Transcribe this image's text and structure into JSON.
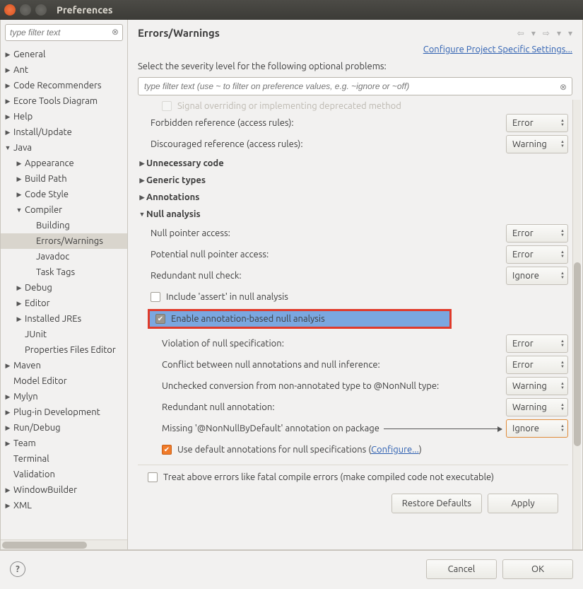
{
  "window": {
    "title": "Preferences"
  },
  "sidebar": {
    "filter_placeholder": "type filter text",
    "items": [
      {
        "label": "General",
        "expand": "▶",
        "depth": 0
      },
      {
        "label": "Ant",
        "expand": "▶",
        "depth": 0
      },
      {
        "label": "Code Recommenders",
        "expand": "▶",
        "depth": 0
      },
      {
        "label": "Ecore Tools Diagram",
        "expand": "▶",
        "depth": 0
      },
      {
        "label": "Help",
        "expand": "▶",
        "depth": 0
      },
      {
        "label": "Install/Update",
        "expand": "▶",
        "depth": 0
      },
      {
        "label": "Java",
        "expand": "▼",
        "depth": 0
      },
      {
        "label": "Appearance",
        "expand": "▶",
        "depth": 1
      },
      {
        "label": "Build Path",
        "expand": "▶",
        "depth": 1
      },
      {
        "label": "Code Style",
        "expand": "▶",
        "depth": 1
      },
      {
        "label": "Compiler",
        "expand": "▼",
        "depth": 1
      },
      {
        "label": "Building",
        "expand": "",
        "depth": 2
      },
      {
        "label": "Errors/Warnings",
        "expand": "",
        "depth": 2,
        "selected": true
      },
      {
        "label": "Javadoc",
        "expand": "",
        "depth": 2
      },
      {
        "label": "Task Tags",
        "expand": "",
        "depth": 2
      },
      {
        "label": "Debug",
        "expand": "▶",
        "depth": 1
      },
      {
        "label": "Editor",
        "expand": "▶",
        "depth": 1
      },
      {
        "label": "Installed JREs",
        "expand": "▶",
        "depth": 1
      },
      {
        "label": "JUnit",
        "expand": "",
        "depth": 1
      },
      {
        "label": "Properties Files Editor",
        "expand": "",
        "depth": 1
      },
      {
        "label": "Maven",
        "expand": "▶",
        "depth": 0
      },
      {
        "label": "Model Editor",
        "expand": "",
        "depth": 0
      },
      {
        "label": "Mylyn",
        "expand": "▶",
        "depth": 0
      },
      {
        "label": "Plug-in Development",
        "expand": "▶",
        "depth": 0
      },
      {
        "label": "Run/Debug",
        "expand": "▶",
        "depth": 0
      },
      {
        "label": "Team",
        "expand": "▶",
        "depth": 0
      },
      {
        "label": "Terminal",
        "expand": "",
        "depth": 0
      },
      {
        "label": "Validation",
        "expand": "",
        "depth": 0
      },
      {
        "label": "WindowBuilder",
        "expand": "▶",
        "depth": 0
      },
      {
        "label": "XML",
        "expand": "▶",
        "depth": 0
      }
    ]
  },
  "main": {
    "title": "Errors/Warnings",
    "config_link": "Configure Project Specific Settings...",
    "instruction": "Select the severity level for the following optional problems:",
    "filter_placeholder": "type filter text (use ~ to filter on preference values, e.g. ~ignore or ~off)",
    "cut_row": "Signal overriding or implementing deprecated method",
    "rows": {
      "forbidden": {
        "label": "Forbidden reference (access rules):",
        "value": "Error"
      },
      "discouraged": {
        "label": "Discouraged reference (access rules):",
        "value": "Warning"
      }
    },
    "sections": {
      "unnecessary": "Unnecessary code",
      "generic": "Generic types",
      "annotations": "Annotations",
      "null": "Null analysis"
    },
    "null": {
      "npe": {
        "label": "Null pointer access:",
        "value": "Error"
      },
      "pot": {
        "label": "Potential null pointer access:",
        "value": "Error"
      },
      "redundant": {
        "label": "Redundant null check:",
        "value": "Ignore"
      },
      "assert": "Include 'assert' in null analysis",
      "enable": "Enable annotation-based null analysis",
      "violation": {
        "label": "Violation of null specification:",
        "value": "Error"
      },
      "conflict": {
        "label": "Conflict between null annotations and null inference:",
        "value": "Error"
      },
      "unchecked": {
        "label": "Unchecked conversion from non-annotated type to @NonNull type:",
        "value": "Warning"
      },
      "redundant_anno": {
        "label": "Redundant null annotation:",
        "value": "Warning"
      },
      "missing": {
        "label": "Missing '@NonNullByDefault' annotation on package",
        "value": "Ignore"
      },
      "use_default_pre": "Use default annotations for null specifications (",
      "configure": "Configure...",
      "use_default_post": ")"
    },
    "treat_fatal": "Treat above errors like fatal compile errors (make compiled code not executable)",
    "restore": "Restore Defaults",
    "apply": "Apply"
  },
  "footer": {
    "cancel": "Cancel",
    "ok": "OK"
  }
}
